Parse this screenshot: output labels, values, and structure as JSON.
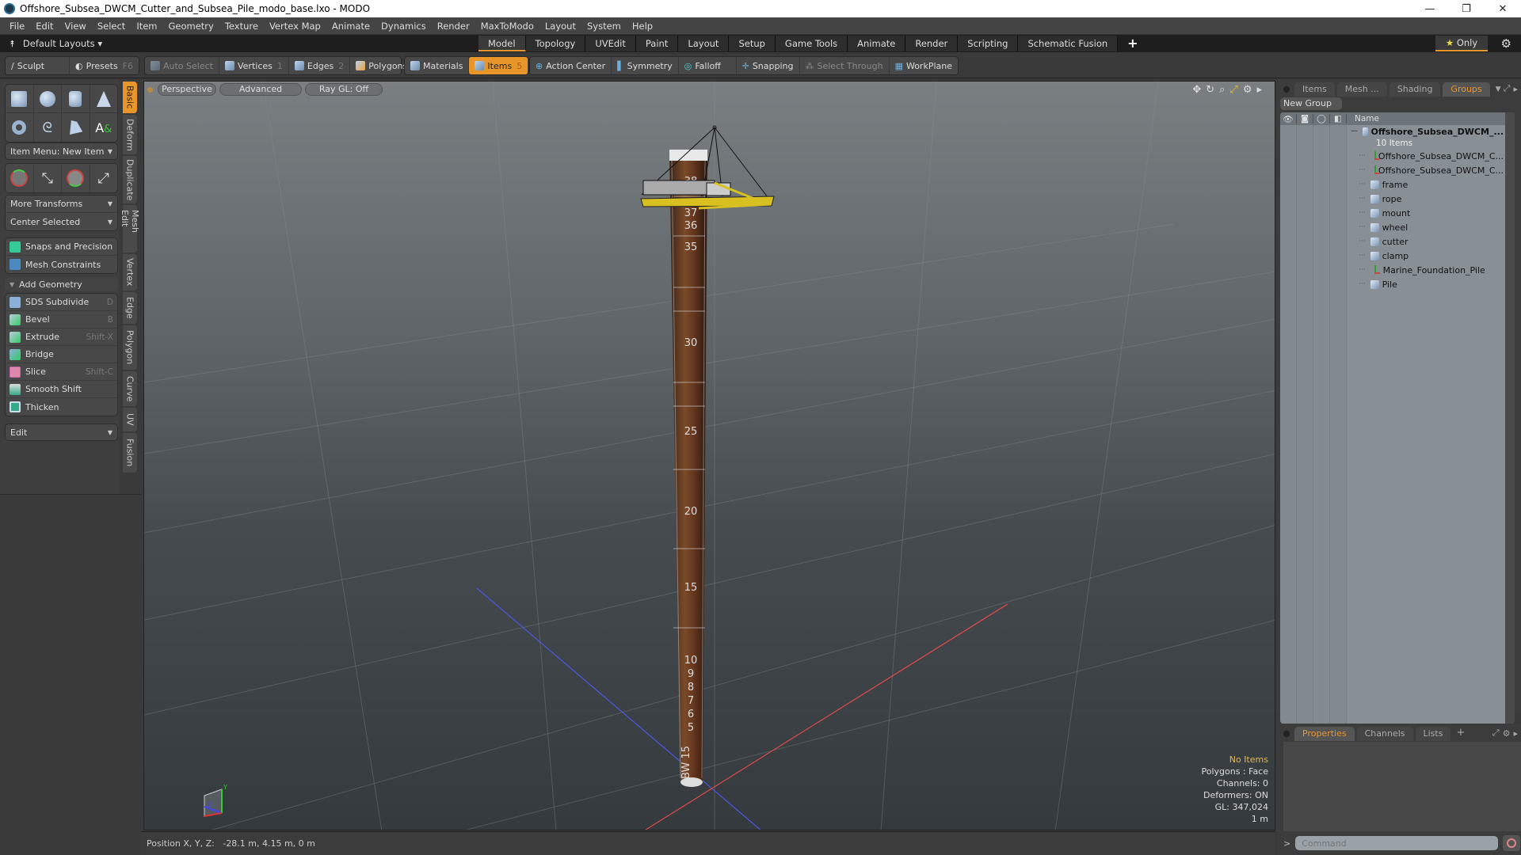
{
  "window": {
    "title": "Offshore_Subsea_DWCM_Cutter_and_Subsea_Pile_modo_base.lxo - MODO",
    "controls": [
      "—",
      "❐",
      "✕"
    ]
  },
  "menu": [
    "File",
    "Edit",
    "View",
    "Select",
    "Item",
    "Geometry",
    "Texture",
    "Vertex Map",
    "Animate",
    "Dynamics",
    "Render",
    "MaxToModo",
    "Layout",
    "System",
    "Help"
  ],
  "layoutbar": {
    "default_layouts": "Default Layouts ▾",
    "tabs": [
      "Model",
      "Topology",
      "UVEdit",
      "Paint",
      "Layout",
      "Setup",
      "Game Tools",
      "Animate",
      "Render",
      "Scripting",
      "Schematic Fusion"
    ],
    "active_tab": "Model",
    "add_tab": "+",
    "only_label": "Only",
    "accent": "#e8962a"
  },
  "toolbar": {
    "sculpt": "Sculpt",
    "presets": "Presets",
    "presets_key": "F6",
    "auto_select": "Auto Select",
    "vertices": "Vertices",
    "vertices_key": "1",
    "edges": "Edges",
    "edges_key": "2",
    "polygons": "Polygons",
    "materials": "Materials",
    "items": "Items",
    "items_key": "5",
    "action_center": "Action Center",
    "symmetry": "Symmetry",
    "falloff": "Falloff",
    "snapping": "Snapping",
    "select_through": "Select Through",
    "workplane": "WorkPlane"
  },
  "leftpanel": {
    "item_menu": "Item Menu: New Item",
    "more_transforms": "More Transforms",
    "center_selected": "Center Selected",
    "snaps": "Snaps and Precision",
    "mesh_constraints": "Mesh Constraints",
    "add_geometry": "Add Geometry",
    "tools": [
      {
        "label": "SDS Subdivide",
        "shortcut": "D"
      },
      {
        "label": "Bevel",
        "shortcut": "B"
      },
      {
        "label": "Extrude",
        "shortcut": "Shift-X"
      },
      {
        "label": "Bridge",
        "shortcut": ""
      },
      {
        "label": "Slice",
        "shortcut": "Shift-C"
      },
      {
        "label": "Smooth Shift",
        "shortcut": ""
      },
      {
        "label": "Thicken",
        "shortcut": ""
      }
    ],
    "edit": "Edit",
    "vtabs": [
      "Basic",
      "Deform",
      "Duplicate",
      "Mesh Edit",
      "Vertex",
      "Edge",
      "Polygon",
      "Curve",
      "UV",
      "Fusion"
    ]
  },
  "viewport": {
    "view": "Perspective",
    "shading": "Advanced",
    "raygl": "Ray GL: Off",
    "hud": {
      "items": "No Items",
      "polygons": "Polygons : Face",
      "channels": "Channels: 0",
      "deformers": "Deformers: ON",
      "gl": "GL: 347,024",
      "scale": "1 m"
    },
    "pile_labels": [
      "38",
      "37",
      "36",
      "35",
      "30",
      "25",
      "20",
      "15",
      "10",
      "9",
      "8",
      "7",
      "6",
      "5",
      "BW 15"
    ]
  },
  "status": {
    "position": "Position X, Y, Z:   -28.1 m, 4.15 m, 0 m"
  },
  "rightpanel": {
    "tabs": [
      "Items",
      "Mesh ...",
      "Shading",
      "Groups"
    ],
    "active_tab": "Groups",
    "new_group": "New Group",
    "name_col": "Name",
    "root": {
      "name": "Offshore_Subsea_DWCM_...",
      "count": "10 Items"
    },
    "items": [
      {
        "name": "Offshore_Subsea_DWCM_C...",
        "type": "locator"
      },
      {
        "name": "Offshore_Subsea_DWCM_C...",
        "type": "locator"
      },
      {
        "name": "frame",
        "type": "mesh"
      },
      {
        "name": "rope",
        "type": "mesh"
      },
      {
        "name": "mount",
        "type": "mesh"
      },
      {
        "name": "wheel",
        "type": "mesh"
      },
      {
        "name": "cutter",
        "type": "mesh"
      },
      {
        "name": "clamp",
        "type": "mesh"
      },
      {
        "name": "Marine_Foundation_Pile",
        "type": "locator"
      },
      {
        "name": "Pile",
        "type": "mesh"
      }
    ]
  },
  "properties": {
    "tabs": [
      "Properties",
      "Channels",
      "Lists"
    ],
    "active_tab": "Properties",
    "add": "+"
  },
  "command": {
    "prompt": ">",
    "placeholder": "Command"
  }
}
